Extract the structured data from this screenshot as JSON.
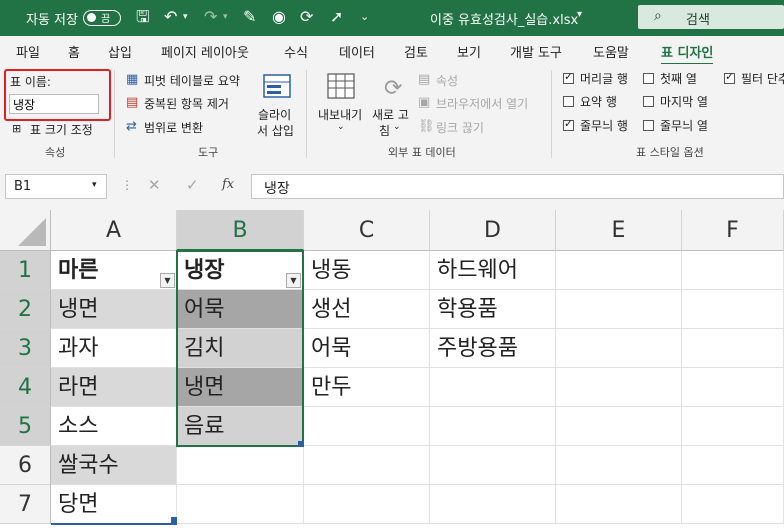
{
  "titlebar": {
    "autosave_label": "자동 저장",
    "autosave_state": "끔",
    "filename": "이중 유효성검사_실습.xlsx",
    "search_placeholder": "검색"
  },
  "tabs": [
    "파일",
    "홈",
    "삽입",
    "페이지 레이아웃",
    "수식",
    "데이터",
    "검토",
    "보기",
    "개발 도구",
    "도움말",
    "표 디자인"
  ],
  "active_tab": "표 디자인",
  "ribbon": {
    "properties": {
      "table_name_label": "표 이름:",
      "table_name_value": "냉장",
      "resize_label": "표 크기 조정",
      "group_label": "속성"
    },
    "tools": {
      "pivot": "피벗 테이블로 요약",
      "remove_dup": "중복된 항목 제거",
      "convert_range": "범위로 변환",
      "slicer_line1": "슬라이",
      "slicer_line2": "서 삽입",
      "group_label": "도구"
    },
    "external": {
      "export_line1": "내보내기",
      "refresh_line1": "새로 고",
      "refresh_line2": "침",
      "properties": "속성",
      "open_browser": "브라우저에서 열기",
      "unlink": "링크 끊기",
      "group_label": "외부 표 데이터"
    },
    "style_options": {
      "header_row": "머리글 행",
      "total_row": "요약 행",
      "banded_rows": "줄무늬 행",
      "first_column": "첫째 열",
      "last_column": "마지막 열",
      "banded_columns": "줄무늬 열",
      "filter_button": "필터 단추",
      "group_label": "표 스타일 옵션"
    }
  },
  "formula_bar": {
    "cell_ref": "B1",
    "content": "냉장"
  },
  "columns": [
    "A",
    "B",
    "C",
    "D",
    "E",
    "F"
  ],
  "rows": [
    "1",
    "2",
    "3",
    "4",
    "5",
    "6",
    "7"
  ],
  "cells": {
    "A": [
      "마른",
      "냉면",
      "과자",
      "라면",
      "소스",
      "쌀국수",
      "당면"
    ],
    "B": [
      "냉장",
      "어묵",
      "김치",
      "냉면",
      "음료",
      "",
      ""
    ],
    "C": [
      "냉동",
      "생선",
      "어묵",
      "만두",
      "",
      "",
      ""
    ],
    "D": [
      "하드웨어",
      "학용품",
      "주방용품",
      "",
      "",
      "",
      ""
    ]
  },
  "colors": {
    "excel_green": "#217346",
    "highlight_red": "#e02020",
    "band_gray": "#d9d9d9",
    "band_selected_gray": "#a6a6a6"
  }
}
